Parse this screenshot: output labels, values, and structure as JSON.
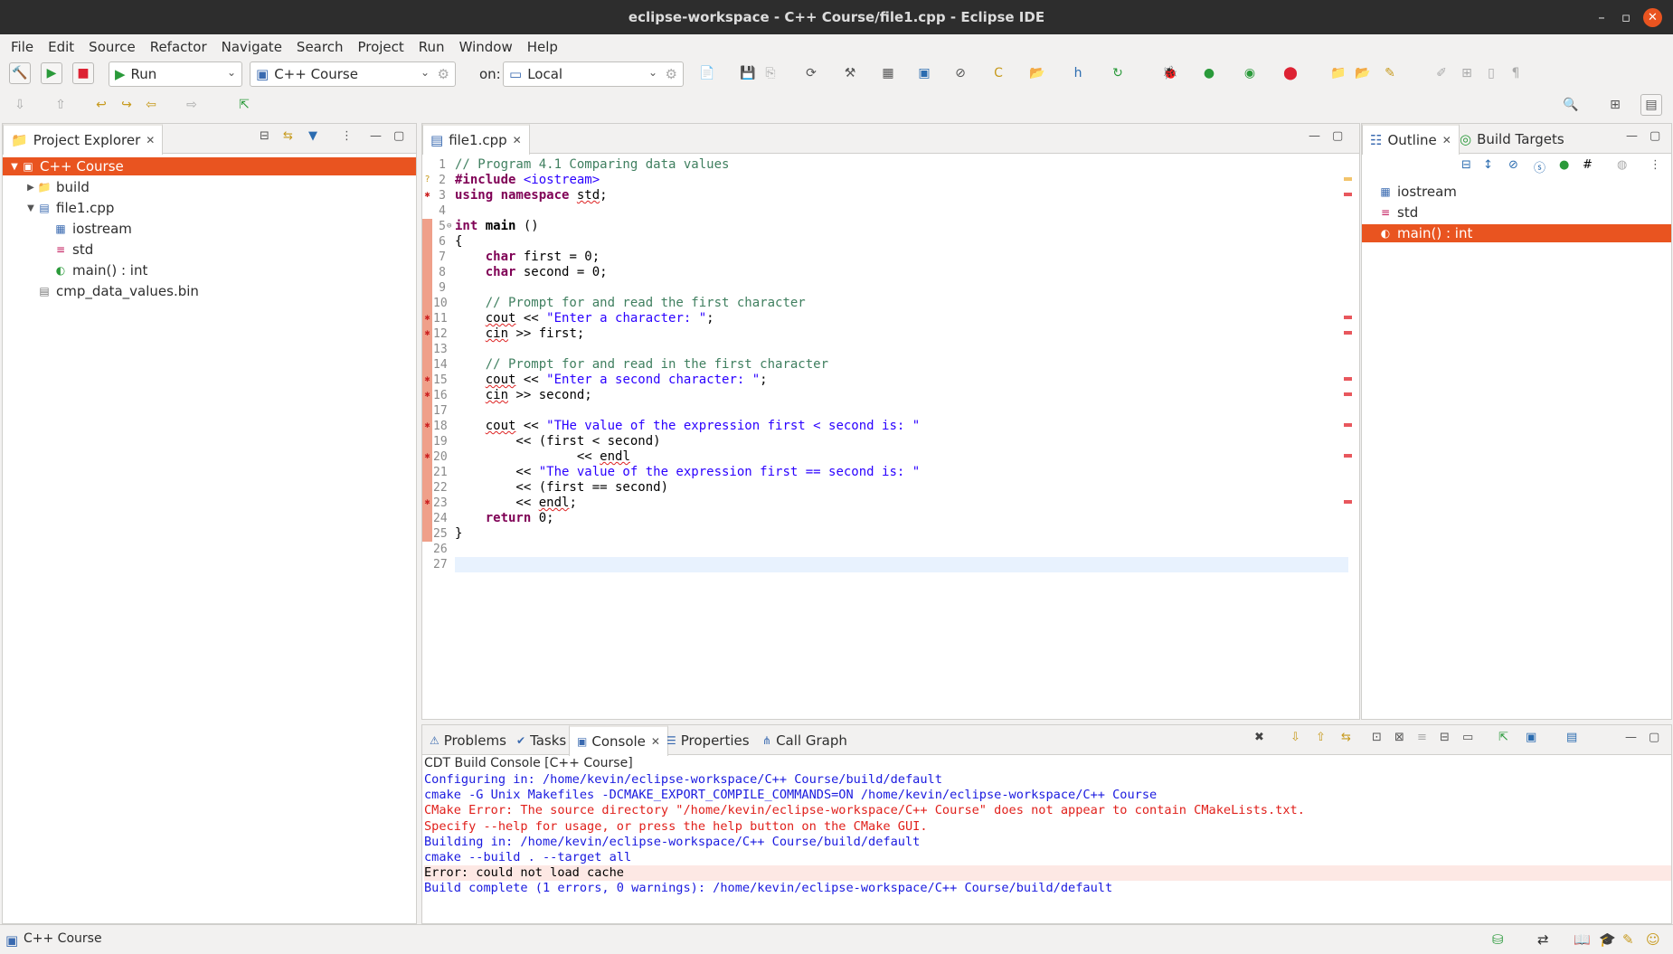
{
  "window": {
    "title": "eclipse-workspace - C++ Course/file1.cpp - Eclipse IDE",
    "min": "–",
    "max": "▫",
    "close": "✕"
  },
  "menu": [
    "File",
    "Edit",
    "Source",
    "Refactor",
    "Navigate",
    "Search",
    "Project",
    "Run",
    "Window",
    "Help"
  ],
  "toolbar": {
    "launch_mode": "Run",
    "launch_config": "C++ Course",
    "on_label": "on:",
    "target": "Local"
  },
  "project_explorer": {
    "tab": "Project Explorer",
    "items": [
      {
        "label": "C++ Course",
        "indent": 0,
        "twisty": "▼",
        "icon": "project-icon",
        "selected": true
      },
      {
        "label": "build",
        "indent": 1,
        "twisty": "▶",
        "icon": "folder-icon"
      },
      {
        "label": "file1.cpp",
        "indent": 1,
        "twisty": "▼",
        "icon": "cpp-file-icon"
      },
      {
        "label": "iostream",
        "indent": 2,
        "twisty": "",
        "icon": "include-icon"
      },
      {
        "label": "std",
        "indent": 2,
        "twisty": "",
        "icon": "namespace-icon"
      },
      {
        "label": "main() : int",
        "indent": 2,
        "twisty": "",
        "icon": "function-icon"
      },
      {
        "label": "cmp_data_values.bin",
        "indent": 1,
        "twisty": "",
        "icon": "binary-file-icon"
      }
    ]
  },
  "editor": {
    "tab": "file1.cpp",
    "lines": [
      {
        "n": "1",
        "html": "<span class='cm'>// Program 4.1 Comparing data values</span>"
      },
      {
        "n": "2",
        "html": "<span class='kw'>#include</span> <span class='st'>&lt;iostream&gt;</span>",
        "marker": "warn"
      },
      {
        "n": "3",
        "html": "<span class='kw'>using namespace</span> <span class='sq'>std</span>;",
        "marker": "err"
      },
      {
        "n": "4",
        "html": ""
      },
      {
        "n": "5",
        "html": "<span class='kw'>int</span> <b>main</b> ()",
        "fold": true
      },
      {
        "n": "6",
        "html": "{"
      },
      {
        "n": "7",
        "html": "    <span class='kw'>char</span> first = 0;"
      },
      {
        "n": "8",
        "html": "    <span class='kw'>char</span> second = 0;"
      },
      {
        "n": "9",
        "html": ""
      },
      {
        "n": "10",
        "html": "    <span class='cm'>// Prompt for and read the first character</span>"
      },
      {
        "n": "11",
        "html": "    <span class='sq'>cout</span> &lt;&lt; <span class='st'>\"Enter a character: \"</span>;",
        "marker": "err"
      },
      {
        "n": "12",
        "html": "    <span class='sq'>cin</span> &gt;&gt; first;",
        "marker": "err"
      },
      {
        "n": "13",
        "html": ""
      },
      {
        "n": "14",
        "html": "    <span class='cm'>// Prompt for and read in the first character</span>"
      },
      {
        "n": "15",
        "html": "    <span class='sq'>cout</span> &lt;&lt; <span class='st'>\"Enter a second character: \"</span>;",
        "marker": "err"
      },
      {
        "n": "16",
        "html": "    <span class='sq'>cin</span> &gt;&gt; second;",
        "marker": "err"
      },
      {
        "n": "17",
        "html": ""
      },
      {
        "n": "18",
        "html": "    <span class='sq'>cout</span> &lt;&lt; <span class='st'>\"THe value of the expression first &lt; second is: \"</span>",
        "marker": "err"
      },
      {
        "n": "19",
        "html": "        &lt;&lt; (first &lt; second)"
      },
      {
        "n": "20",
        "html": "                &lt;&lt; <span class='sq'>endl</span>",
        "marker": "err"
      },
      {
        "n": "21",
        "html": "        &lt;&lt; <span class='st'>\"The value of the expression first == second is: \"</span>"
      },
      {
        "n": "22",
        "html": "        &lt;&lt; (first == second)"
      },
      {
        "n": "23",
        "html": "        &lt;&lt; <span class='sq'>endl</span>;",
        "marker": "err"
      },
      {
        "n": "24",
        "html": "    <span class='kw'>return</span> 0;"
      },
      {
        "n": "25",
        "html": "}"
      },
      {
        "n": "26",
        "html": ""
      },
      {
        "n": "27",
        "html": "",
        "current": true
      }
    ]
  },
  "outline": {
    "tabs": [
      "Outline",
      "Build Targets"
    ],
    "items": [
      {
        "label": "iostream",
        "icon": "include-icon"
      },
      {
        "label": "std",
        "icon": "namespace-icon"
      },
      {
        "label": "main() : int",
        "icon": "function-icon",
        "selected": true
      }
    ]
  },
  "bottom": {
    "tabs": [
      "Problems",
      "Tasks",
      "Console",
      "Properties",
      "Call Graph"
    ],
    "active": "Console",
    "console_title": "CDT Build Console [C++ Course]",
    "lines": [
      {
        "text": "Configuring in: /home/kevin/eclipse-workspace/C++ Course/build/default",
        "color": "#1a1adf"
      },
      {
        "text": "cmake -G Unix Makefiles -DCMAKE_EXPORT_COMPILE_COMMANDS=ON /home/kevin/eclipse-workspace/C++ Course",
        "color": "#1a1adf"
      },
      {
        "text": "CMake Error: The source directory \"/home/kevin/eclipse-workspace/C++ Course\" does not appear to contain CMakeLists.txt.",
        "color": "#e0201b"
      },
      {
        "text": "Specify --help for usage, or press the help button on the CMake GUI.",
        "color": "#e0201b"
      },
      {
        "text": "Building in: /home/kevin/eclipse-workspace/C++ Course/build/default",
        "color": "#1a1adf"
      },
      {
        "text": "cmake --build . --target all",
        "color": "#1a1adf"
      },
      {
        "text": "Error: could not load cache",
        "color": "#000000",
        "highlight": true
      },
      {
        "text": "Build complete (1 errors, 0 warnings): /home/kevin/eclipse-workspace/C++ Course/build/default",
        "color": "#1a1adf"
      }
    ]
  },
  "status": {
    "project": "C++ Course"
  },
  "colors": {
    "accent": "#e95420",
    "error": "#e8575d"
  }
}
